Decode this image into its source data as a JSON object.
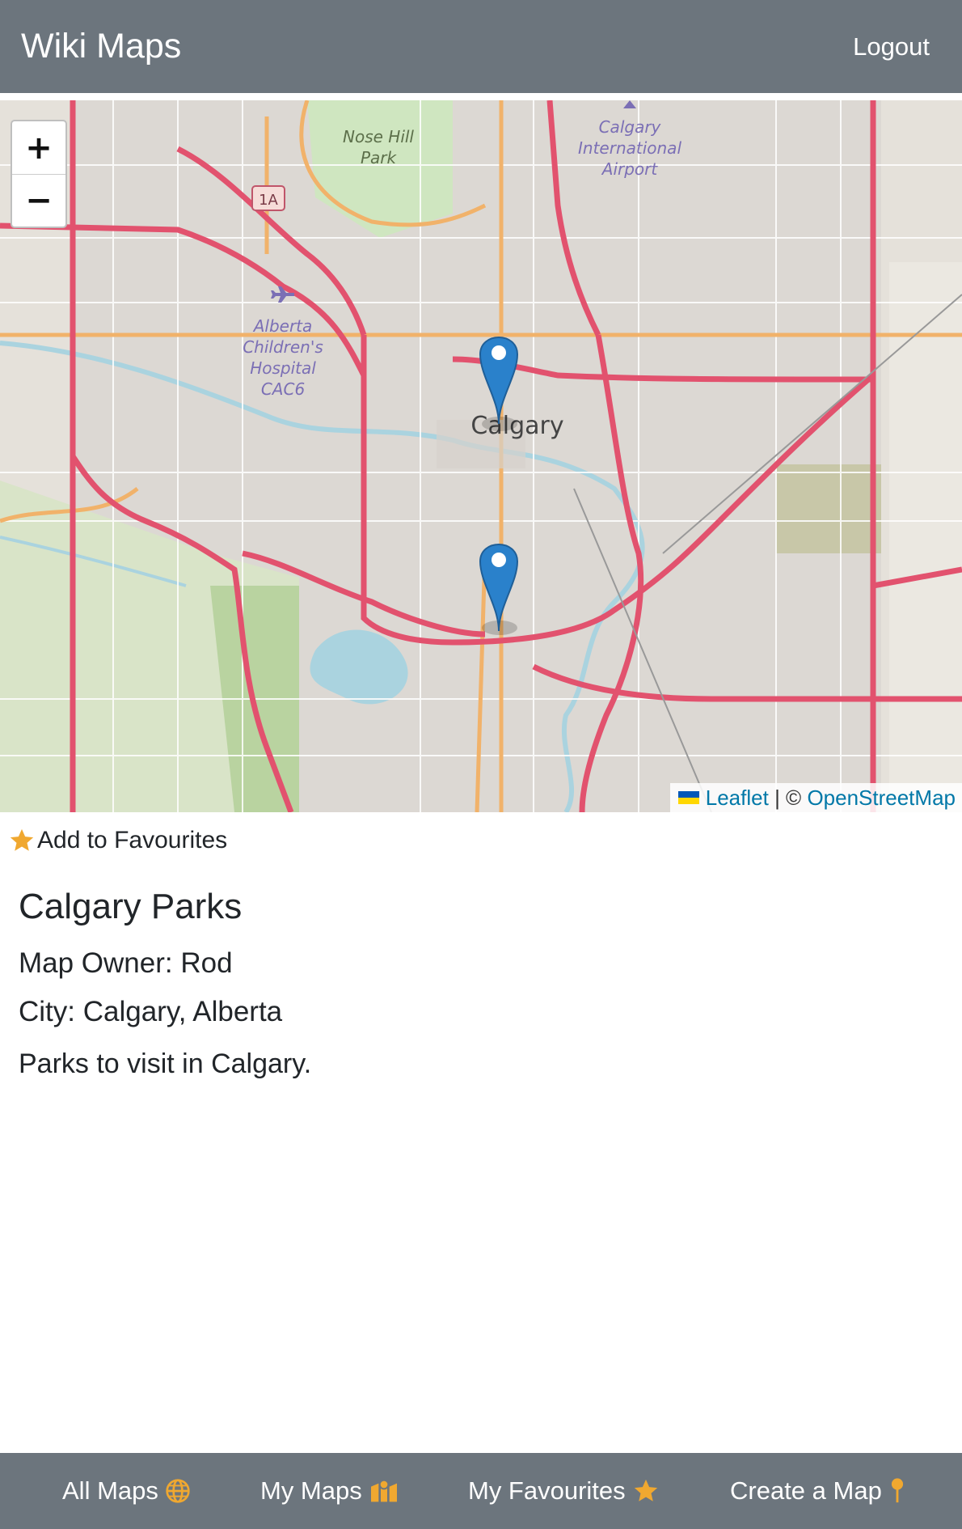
{
  "header": {
    "brand": "Wiki Maps",
    "logout_label": "Logout"
  },
  "map": {
    "zoom_in_label": "+",
    "zoom_out_label": "−",
    "place_labels": [
      "Calgary",
      "Nose Hill",
      "Park",
      "Calgary",
      "International",
      "Airport",
      "Alberta",
      "Children's",
      "Hospital",
      "CAC6",
      "1A"
    ],
    "markers": [
      {
        "name": "marker-downtown"
      },
      {
        "name": "marker-south"
      }
    ],
    "attribution": {
      "leaflet_label": "Leaflet",
      "separator": " | © ",
      "osm_label": "OpenStreetMap"
    }
  },
  "favourite": {
    "label": "Add to Favourites",
    "icon": "star-icon",
    "icon_color": "#f0a830"
  },
  "details": {
    "title": "Calgary Parks",
    "owner": "Map Owner: Rod",
    "city": "City: Calgary, Alberta",
    "description": "Parks to visit in Calgary."
  },
  "footer": {
    "items": [
      {
        "label": "All Maps",
        "icon": "globe-icon"
      },
      {
        "label": "My Maps",
        "icon": "map-icon"
      },
      {
        "label": "My Favourites",
        "icon": "star-icon"
      },
      {
        "label": "Create a Map",
        "icon": "pin-icon"
      }
    ],
    "icon_color": "#f0a830"
  },
  "colors": {
    "navbar": "#6c757d",
    "highway": "#e2526e",
    "arterial": "#f1b26a",
    "marker": "#2a81cb"
  }
}
